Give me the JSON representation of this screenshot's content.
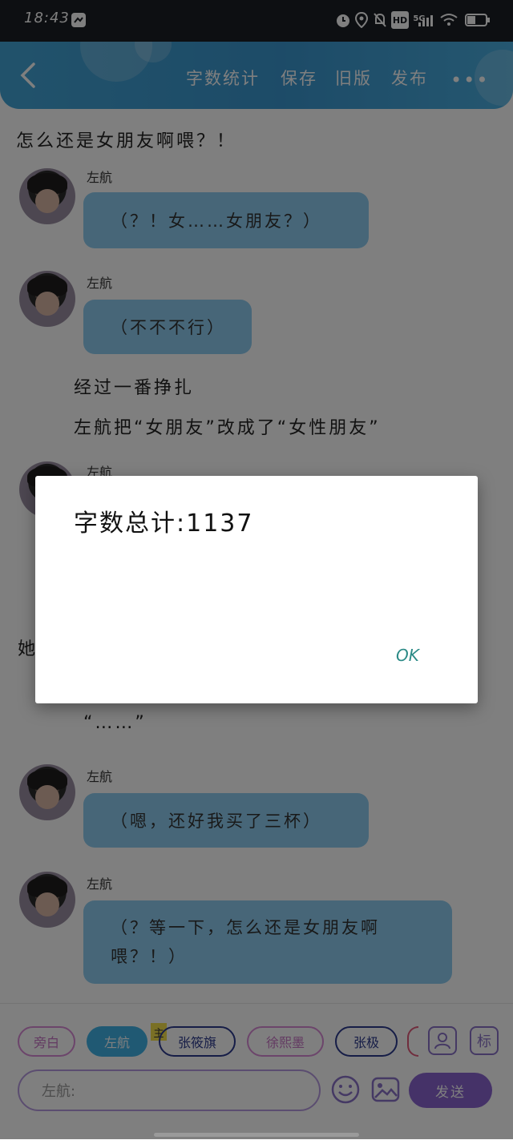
{
  "status_bar": {
    "time": "18:43",
    "network": "5G",
    "hd": "HD",
    "battery": "45"
  },
  "header": {
    "back_icon": "back-chevron",
    "menu": [
      "字数统计",
      "保存",
      "旧版",
      "发布"
    ],
    "more_icon": "more-dots"
  },
  "chat": {
    "line1": "怎么还是女朋友啊喂？！",
    "msg1": {
      "speaker": "左航",
      "text": "（？！女……女朋友？）"
    },
    "msg2": {
      "speaker": "左航",
      "text": "（不不不行）"
    },
    "narration2": "经过一番挣扎",
    "narration3": "左航把“女朋友”改成了“女性朋友”",
    "msg3_speaker": "左航",
    "partial_left": "她",
    "quote": "“……”",
    "msg4": {
      "speaker": "左航",
      "text": "（嗯，还好我买了三杯）"
    },
    "msg5": {
      "speaker": "左航",
      "text_line1": "（？等一下，怎么还是女朋友啊",
      "text_line2": "喂？！）"
    }
  },
  "dialog": {
    "title": "字数总计:1137",
    "ok": "OK"
  },
  "bottom": {
    "roles": [
      "旁白",
      "左航",
      "张筱旗",
      "徐熙墨",
      "张极"
    ],
    "main_badge": "主",
    "tool_person_icon": "person-icon",
    "tool_mark_label": "标",
    "input_placeholder": "左航:",
    "emoji_icon": "emoji-icon",
    "image_icon": "image-icon",
    "send_label": "发送"
  },
  "colors": {
    "header": "#3a97d0",
    "bubble": "#8ecdf0",
    "accent_purple": "#8a64d0",
    "ok_teal": "#2b8a86"
  }
}
